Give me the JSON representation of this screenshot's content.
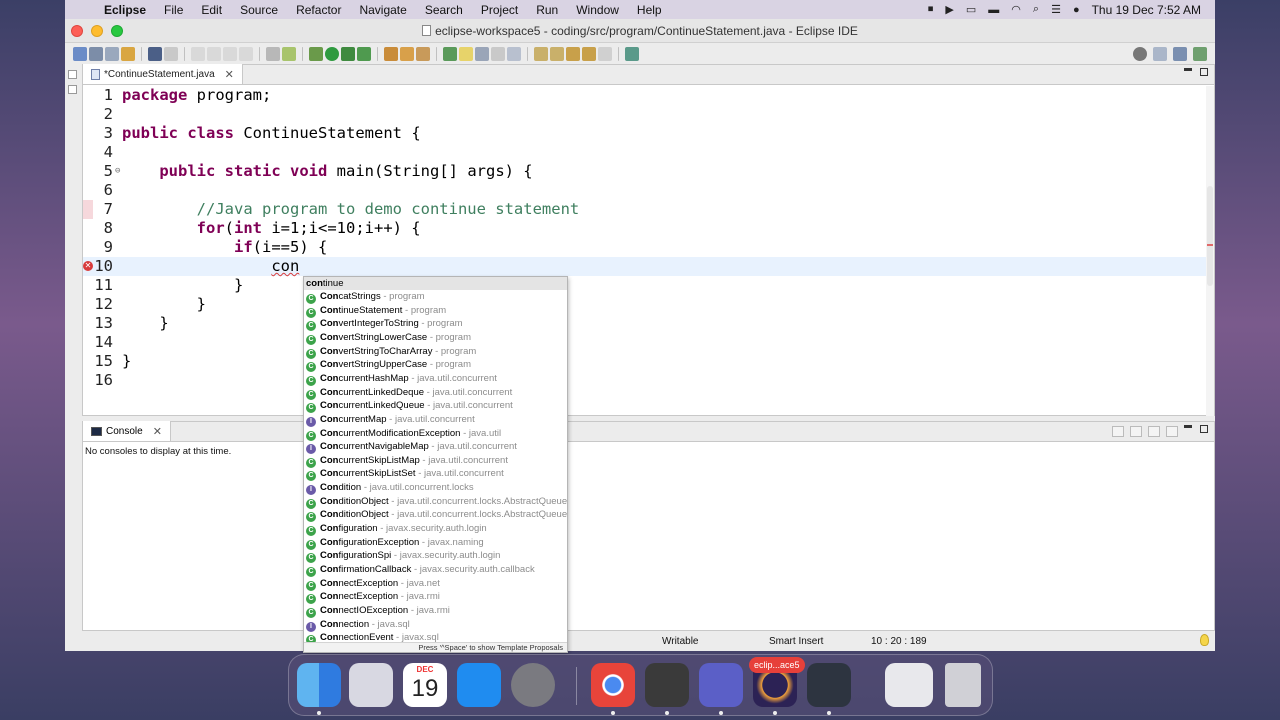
{
  "menubar": {
    "app_name": "Eclipse",
    "menus": [
      "File",
      "Edit",
      "Source",
      "Refactor",
      "Navigate",
      "Search",
      "Project",
      "Run",
      "Window",
      "Help"
    ],
    "datetime": "Thu 19 Dec  7:52 AM"
  },
  "window": {
    "title": "eclipse-workspace5 - coding/src/program/ContinueStatement.java - Eclipse IDE"
  },
  "editor": {
    "tab_label": "*ContinueStatement.java",
    "lines": [
      {
        "num": "1",
        "text": "package program;"
      },
      {
        "num": "2",
        "text": ""
      },
      {
        "num": "3",
        "text": "public class ContinueStatement {"
      },
      {
        "num": "4",
        "text": ""
      },
      {
        "num": "5",
        "text": "    public static void main(String[] args) {"
      },
      {
        "num": "6",
        "text": ""
      },
      {
        "num": "7",
        "text": "        //Java program to demo continue statement"
      },
      {
        "num": "8",
        "text": "        for(int i=1;i<=10;i++) {"
      },
      {
        "num": "9",
        "text": "            if(i==5) {"
      },
      {
        "num": "10",
        "text": "                con"
      },
      {
        "num": "11",
        "text": "            }"
      },
      {
        "num": "12",
        "text": "        }"
      },
      {
        "num": "13",
        "text": "    }"
      },
      {
        "num": "14",
        "text": ""
      },
      {
        "num": "15",
        "text": "}"
      },
      {
        "num": "16",
        "text": ""
      }
    ]
  },
  "completion": {
    "first_bold": "con",
    "first_rest": "tinue",
    "proposals": [
      {
        "bold": "Con",
        "rest": "catStrings",
        "pkg": " - program",
        "kind": "class"
      },
      {
        "bold": "Con",
        "rest": "tinueStatement",
        "pkg": " - program",
        "kind": "class"
      },
      {
        "bold": "Con",
        "rest": "vertIntegerToString",
        "pkg": " - program",
        "kind": "class"
      },
      {
        "bold": "Con",
        "rest": "vertStringLowerCase",
        "pkg": " - program",
        "kind": "class"
      },
      {
        "bold": "Con",
        "rest": "vertStringToCharArray",
        "pkg": " - program",
        "kind": "class"
      },
      {
        "bold": "Con",
        "rest": "vertStringUpperCase",
        "pkg": " - program",
        "kind": "class"
      },
      {
        "bold": "Con",
        "rest": "currentHashMap",
        "pkg": " - java.util.concurrent",
        "kind": "class"
      },
      {
        "bold": "Con",
        "rest": "currentLinkedDeque",
        "pkg": " - java.util.concurrent",
        "kind": "class"
      },
      {
        "bold": "Con",
        "rest": "currentLinkedQueue",
        "pkg": " - java.util.concurrent",
        "kind": "class"
      },
      {
        "bold": "Con",
        "rest": "currentMap",
        "pkg": " - java.util.concurrent",
        "kind": "interface"
      },
      {
        "bold": "Con",
        "rest": "currentModificationException",
        "pkg": " - java.util",
        "kind": "class"
      },
      {
        "bold": "Con",
        "rest": "currentNavigableMap",
        "pkg": " - java.util.concurrent",
        "kind": "interface"
      },
      {
        "bold": "Con",
        "rest": "currentSkipListMap",
        "pkg": " - java.util.concurrent",
        "kind": "class"
      },
      {
        "bold": "Con",
        "rest": "currentSkipListSet",
        "pkg": " - java.util.concurrent",
        "kind": "class"
      },
      {
        "bold": "Con",
        "rest": "dition",
        "pkg": " - java.util.concurrent.locks",
        "kind": "interface"
      },
      {
        "bold": "Con",
        "rest": "ditionObject",
        "pkg": " - java.util.concurrent.locks.AbstractQueue",
        "kind": "class"
      },
      {
        "bold": "Con",
        "rest": "ditionObject",
        "pkg": " - java.util.concurrent.locks.AbstractQueue",
        "kind": "class"
      },
      {
        "bold": "Con",
        "rest": "figuration",
        "pkg": " - javax.security.auth.login",
        "kind": "class"
      },
      {
        "bold": "Con",
        "rest": "figurationException",
        "pkg": " - javax.naming",
        "kind": "class"
      },
      {
        "bold": "Con",
        "rest": "figurationSpi",
        "pkg": " - javax.security.auth.login",
        "kind": "class"
      },
      {
        "bold": "Con",
        "rest": "firmationCallback",
        "pkg": " - javax.security.auth.callback",
        "kind": "class"
      },
      {
        "bold": "Con",
        "rest": "nectException",
        "pkg": " - java.net",
        "kind": "class"
      },
      {
        "bold": "Con",
        "rest": "nectException",
        "pkg": " - java.rmi",
        "kind": "class"
      },
      {
        "bold": "Con",
        "rest": "nectIOException",
        "pkg": " - java.rmi",
        "kind": "class"
      },
      {
        "bold": "Con",
        "rest": "nection",
        "pkg": " - java.sql",
        "kind": "interface"
      },
      {
        "bold": "Con",
        "rest": "nectionEvent",
        "pkg": " - javax.sql",
        "kind": "class"
      }
    ],
    "footer": "Press '^Space' to show Template Proposals"
  },
  "console": {
    "tab_label": "Console",
    "message": "No consoles to display at this time."
  },
  "statusbar": {
    "writable": "Writable",
    "insert_mode": "Smart Insert",
    "position": "10 : 20 : 189"
  },
  "dock": {
    "calendar_month": "DEC",
    "calendar_day": "19",
    "eclipse_badge": "eclip...ace5"
  }
}
